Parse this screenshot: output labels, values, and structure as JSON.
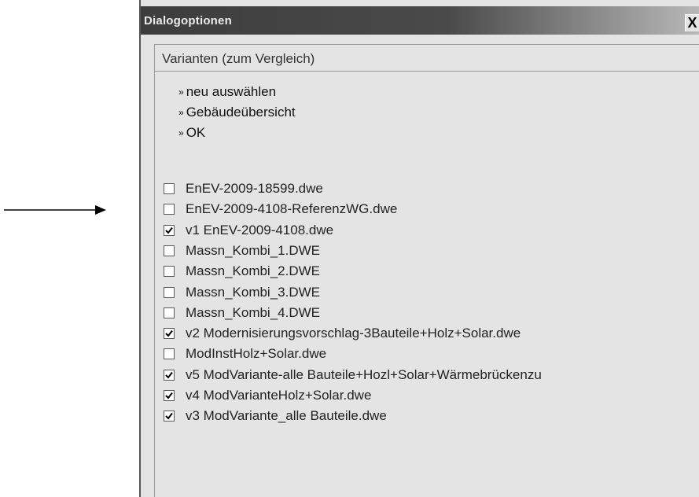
{
  "dialog": {
    "title": "Dialogoptionen",
    "close_label": "X"
  },
  "section": {
    "title": "Varianten (zum Vergleich)"
  },
  "actions": [
    {
      "label": "neu auswählen"
    },
    {
      "label": "Gebäudeübersicht"
    },
    {
      "label": "OK"
    }
  ],
  "variants": [
    {
      "label": "EnEV-2009-18599.dwe",
      "checked": false
    },
    {
      "label": "EnEV-2009-4108-ReferenzWG.dwe",
      "checked": false
    },
    {
      "label": "v1 EnEV-2009-4108.dwe",
      "checked": true
    },
    {
      "label": "Massn_Kombi_1.DWE",
      "checked": false
    },
    {
      "label": "Massn_Kombi_2.DWE",
      "checked": false
    },
    {
      "label": "Massn_Kombi_3.DWE",
      "checked": false
    },
    {
      "label": "Massn_Kombi_4.DWE",
      "checked": false
    },
    {
      "label": "v2 Modernisierungsvorschlag-3Bauteile+Holz+Solar.dwe",
      "checked": true
    },
    {
      "label": "ModInstHolz+Solar.dwe",
      "checked": false
    },
    {
      "label": "v5 ModVariante-alle Bauteile+Hozl+Solar+Wärmebrückenzu",
      "checked": true
    },
    {
      "label": "v4 ModVarianteHolz+Solar.dwe",
      "checked": true
    },
    {
      "label": "v3 ModVariante_alle Bauteile.dwe",
      "checked": true
    }
  ],
  "colors": {
    "dialog_bg": "#e4e4e4",
    "titlebar_dark": "#3d3d3d",
    "titlebar_light": "#b8b8b8"
  }
}
